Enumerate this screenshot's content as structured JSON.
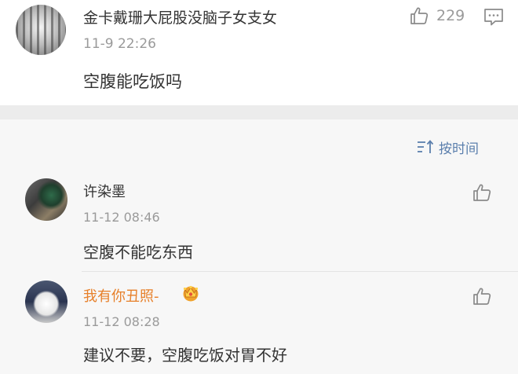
{
  "main_comment": {
    "username": "金卡戴珊大屁股没脑子女支女",
    "timestamp": "11-9 22:26",
    "content": "空腹能吃饭吗",
    "like_count": "229",
    "icons": {
      "like": "thumbs-up-icon",
      "comment": "comment-icon"
    }
  },
  "replies_header": {
    "sort_label": "按时间",
    "sort_icon": "sort-icon"
  },
  "replies": [
    {
      "username": "许染墨",
      "timestamp": "11-12 08:46",
      "content": "空腹不能吃东西",
      "icon": "thumbs-up-icon"
    },
    {
      "username": "我有你丑照-",
      "timestamp": "11-12 08:28",
      "content": "建议不要，空腹吃饭对胃不好",
      "badge_icon": "crown-icon",
      "icon": "thumbs-up-icon"
    }
  ],
  "colors": {
    "link_blue": "#5b7fad",
    "vip_orange": "#e7802a",
    "meta_gray": "#9a9a9a",
    "text": "#333333",
    "band": "#ececec",
    "reply_bg": "#f7f7f7"
  }
}
